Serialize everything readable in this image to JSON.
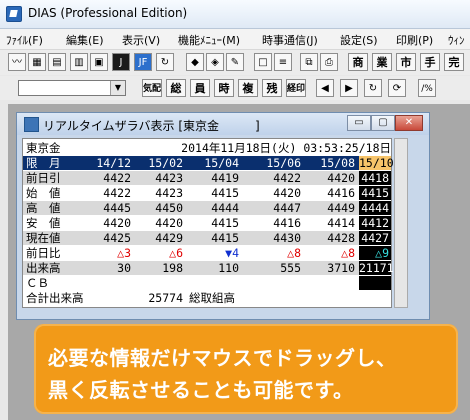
{
  "app": {
    "title": "DIAS (Professional Edition)"
  },
  "menu": [
    "ﾌｧｲﾙ(F)",
    "編集(E)",
    "表示(V)",
    "機能ﾒﾆｭｰ(M)",
    "時事通信(J)",
    "設定(S)",
    "印刷(P)",
    "ｳｨﾝ"
  ],
  "toolbar1": {
    "buttons": [
      "chart-icon",
      "table-icon",
      "grid-icon",
      "list-icon",
      "j-icon",
      "jf-icon",
      "refresh-icon",
      "tag-icon",
      "note-icon",
      "edit-icon",
      "blank-icon",
      "stack-icon",
      "print-icon"
    ],
    "text_buttons": [
      "商",
      "業",
      "市",
      "手",
      "完"
    ]
  },
  "toolbar2": {
    "combo_value": "",
    "text_buttons": [
      "気配",
      "総",
      "員",
      "時",
      "複",
      "残",
      "経印"
    ],
    "nav": [
      "◀",
      "▶",
      "↻",
      "⟳",
      "/%"
    ]
  },
  "child": {
    "title": "リアルタイムザラバ表示 [東京金　　　]",
    "buttons": {
      "min": "▭",
      "max": "▢",
      "close": "✕"
    }
  },
  "board": {
    "header_left": "東京金",
    "header_right": "2014年11月18日(火) 03:53:25/18日",
    "months_label": "限　月",
    "months": [
      "14/12",
      "15/02",
      "15/04",
      "15/06",
      "15/08",
      "15/10"
    ],
    "rows": [
      {
        "label": "前日引",
        "values": [
          "4422",
          "4423",
          "4419",
          "4422",
          "4420",
          "4418"
        ]
      },
      {
        "label": "始　値",
        "values": [
          "4422",
          "4423",
          "4415",
          "4420",
          "4416",
          "4415"
        ]
      },
      {
        "label": "高　値",
        "values": [
          "4445",
          "4450",
          "4444",
          "4447",
          "4449",
          "4444"
        ]
      },
      {
        "label": "安　値",
        "values": [
          "4420",
          "4420",
          "4415",
          "4416",
          "4414",
          "4412"
        ]
      },
      {
        "label": "現在値",
        "values": [
          "4425",
          "4429",
          "4415",
          "4430",
          "4428",
          "4427"
        ]
      },
      {
        "label": "前日比",
        "values": [
          "△3",
          "△6",
          "▼4",
          "△8",
          "△8",
          "△9"
        ]
      },
      {
        "label": "出来高",
        "values": [
          "30",
          "198",
          "110",
          "555",
          "3710",
          "21171"
        ]
      },
      {
        "label": "ＣＢ",
        "values": [
          "",
          "",
          "",
          "",
          "",
          ""
        ]
      }
    ],
    "footer_label": "合計出来高",
    "footer_value": "25774",
    "footer_tail": "総取組高"
  },
  "banner": {
    "line1": "必要な情報だけマウスでドラッグし、",
    "line2": "黒く反転させることも可能です。"
  },
  "colors": {
    "header_bg": "#0a2f6e",
    "selected_month_bg": "#f7c46a",
    "highlight_bg": "#000000",
    "banner_bg": "#f29a18",
    "up": "#e00000",
    "down": "#1030d0"
  }
}
